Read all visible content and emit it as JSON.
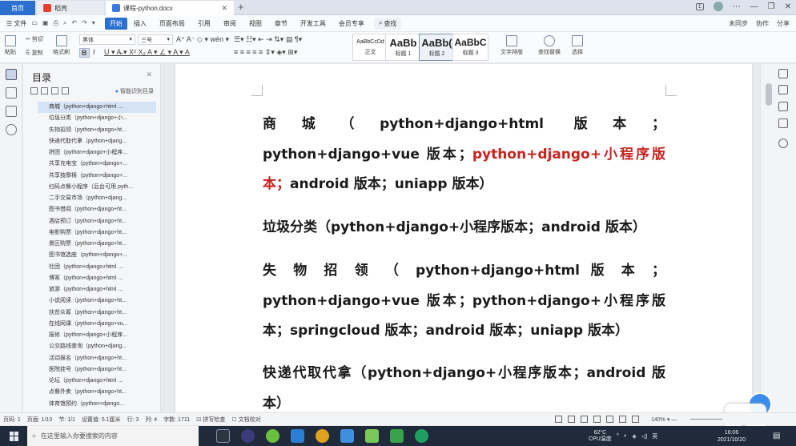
{
  "titlebar": {
    "tabs": [
      {
        "label": "首页"
      },
      {
        "label": "稻壳"
      },
      {
        "label": "课程-python.docx"
      }
    ],
    "new_tab": "+",
    "badge": "1"
  },
  "menubar": {
    "file_menu": "☰ 文件",
    "items": [
      "开始",
      "插入",
      "页面布局",
      "引用",
      "审阅",
      "视图",
      "章节",
      "开发工具",
      "会员专享"
    ],
    "active": "开始",
    "search": "查找",
    "right": [
      "未同步",
      "协作",
      "分享"
    ]
  },
  "ribbon": {
    "paste": "粘贴",
    "cut": "剪切",
    "copy": "复制",
    "format_painter": "格式刷",
    "font_name": "黑体",
    "font_size": "三号",
    "styles": [
      {
        "preview": "AaBbCcDd",
        "label": "正文"
      },
      {
        "preview": "AaBb",
        "label": "标题 1"
      },
      {
        "preview": "AaBb(",
        "label": "标题 2"
      },
      {
        "preview": "AaBbC",
        "label": "标题 3"
      }
    ],
    "text_layout": "文字排版",
    "find_replace": "查找替换",
    "select": "选择"
  },
  "nav": {
    "title": "目录",
    "smart_toc": "智能识别目录",
    "items": [
      "商城（python+django+html ...",
      "垃圾分类（python+django+小...",
      "失物招领（python+django+ht...",
      "快递代取代拿（python+djang...",
      "拼团（python+django+小程序...",
      "共享充电宝（python+django+...",
      "共享按摩椅（python+django+...",
      "扫码点餐小程序（后台可用 pyth...",
      "二手交易市场（python+djang...",
      "图书借阅（python+django+ht...",
      "酒店预订（python+django+ht...",
      "电影购票（python+django+ht...",
      "景区购票（python+django+ht...",
      "图书馆选座（python+django+...",
      "社团（python+django+html ...",
      "博客（python+django+html ...",
      "旅游（python+django+html ...",
      "小说阅读（python+django+ht...",
      "扶贫众筹（python+django+ht...",
      "在线网课（python+django+vu...",
      "报修（python+django+小程序...",
      "公交路线查询（python+djang...",
      "活动报名（python+django+ht...",
      "医院挂号（python+django+ht...",
      "论坛（python+django+html ...",
      "点餐外卖（python+django+ht...",
      "体育馆预约（python+django..."
    ]
  },
  "document": {
    "p1_a": "商城（python+django+html 版本；python+django+vue 版本；",
    "p1_red": "python+django+小程序版本；",
    "p1_b": "android 版本；uniapp 版本）",
    "p2": "垃圾分类（python+django+小程序版本；android 版本）",
    "p3": "失 物 招 领 （ python+django+html 版 本 ； python+django+vue 版本；python+django+小程序版本；springcloud 版本；android 版本；uniapp 版本）",
    "p4": "快递代取代拿（python+django+小程序版本；android 版本）"
  },
  "statusbar": {
    "page": "页码: 1",
    "pages": "页面: 1/10",
    "section": "节: 1/1",
    "position": "设置值: 5.1厘米",
    "row": "行: 3",
    "col": "列: 4",
    "words": "字数: 1711",
    "spell": "拼写检查",
    "proof": "文档校对",
    "zoom": "140%"
  },
  "taskbar": {
    "search_placeholder": "在这里输入你要搜索的内容",
    "weather_temp": "62°C",
    "weather_label": "CPU温度",
    "ime": "英",
    "time": "16:06",
    "date": "2021/10/20"
  },
  "colors": {
    "accent": "#2b6fcf",
    "highlight_red": "#c9211e",
    "taskbar": "#1f2a3a"
  }
}
